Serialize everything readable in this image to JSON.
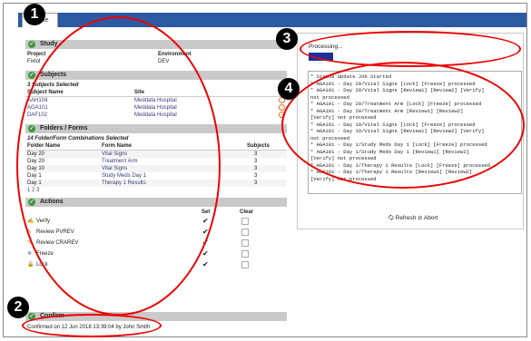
{
  "tab": {
    "label": "Update"
  },
  "study": {
    "title": "Study",
    "project_label": "Project",
    "project_value": "Fixtol",
    "env_label": "Environment",
    "env_value": "DEV"
  },
  "subjects": {
    "title": "Subjects",
    "selected": "3 Subjects Selected",
    "col_name": "Subject Name",
    "col_site": "Site",
    "rows": [
      {
        "name": "AAH104",
        "site": "Meddata Hospital"
      },
      {
        "name": "AGA101",
        "site": "Meddata Hospital"
      },
      {
        "name": "DAF102",
        "site": "Meddata Hospital"
      }
    ]
  },
  "folders": {
    "title": "Folders / Forms",
    "selected": "14 Folder/Form Combinations Selected",
    "col_folder": "Folder Name",
    "col_form": "Form Name",
    "col_subjects": "Subjects",
    "rows": [
      {
        "folder": "Day 20",
        "form": "Vital Signs",
        "subjects": "3"
      },
      {
        "folder": "Day 20",
        "form": "Treatment Arm",
        "subjects": "3"
      },
      {
        "folder": "Day 10",
        "form": "Vital Signs",
        "subjects": "3"
      },
      {
        "folder": "Day 1",
        "form": "Study Meds Day 1",
        "subjects": "3"
      },
      {
        "folder": "Day 1",
        "form": "Therapy 1 Results",
        "subjects": "3"
      }
    ],
    "pages": "1 2 3"
  },
  "actions": {
    "title": "Actions",
    "col_set": "Set",
    "col_clear": "Clear",
    "rows": [
      {
        "label": "Verify",
        "set": true
      },
      {
        "label": "Review  PVREV",
        "set": true
      },
      {
        "label": "Review  CRAREV",
        "set": true
      },
      {
        "label": "Freeze",
        "set": true
      },
      {
        "label": "Lock",
        "set": true
      }
    ]
  },
  "confirm": {
    "title": "Confirm",
    "text": "Confirmed on 12 Jun 2018 13:39:04 by John Smith"
  },
  "progress": {
    "label": "Processing...",
    "fraction": 0.12
  },
  "log": {
    "lines": [
      "* Status Update Job Started",
      "* AGA101 - Day 20/Vital Signs [Lock] [Freeze] processed",
      "* AGA101 - Day 20/Vital Signs [Review1] [Review2] [Verify]",
      "not processed",
      "* AGA101 - Day 20/Treatment Arm [Lock] [Freeze] processed",
      "* AGA101 - Day 20/Treatment Arm [Review1] [Review2]",
      "[Verify] not processed",
      "* AGA101 - Day 10/Vital Signs [Lock] [Freeze] processed",
      "* AGA101 - Day 10/Vital Signs [Review1] [Review2] [Verify]",
      "not processed",
      "* AGA101 - Day 1/Study Meds Day 1 [Lock] [Freeze] processed",
      "* AGA101 - Day 1/Study Meds Day 1 [Review1] [Review2]",
      "[Verify] not processed",
      "* AGA101 - Day 1/Therapy 1 Results [Lock] [Freeze] processed",
      "* AGA101 - Day 1/Therapy 1 Results [Review1] [Review2]",
      "[Verify] not processed"
    ]
  },
  "buttons": {
    "refresh": "Refresh",
    "abort": "Abort"
  },
  "callouts": [
    "1",
    "2",
    "3",
    "4"
  ],
  "colors": {
    "accent": "#2b5aa0",
    "oval": "#ee0000",
    "progress": "#1f2f9a"
  }
}
